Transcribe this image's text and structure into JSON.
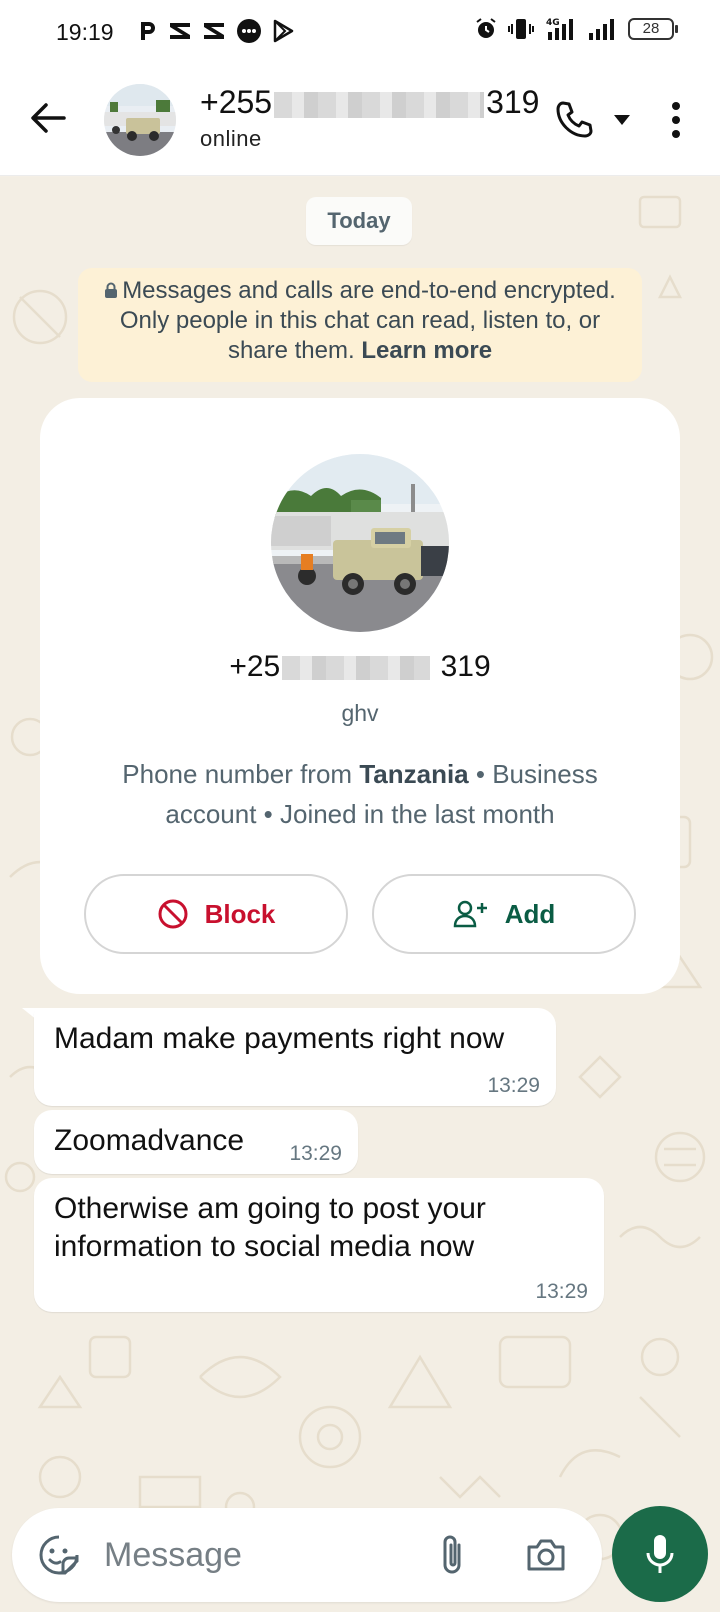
{
  "status_bar": {
    "time": "19:19",
    "battery": "28",
    "network": "4G",
    "icons_left": [
      "p-icon",
      "capcut-icon",
      "capcut-icon",
      "messenger-icon",
      "play-store-icon"
    ],
    "icons_right": [
      "alarm-icon",
      "vibrate-icon",
      "signal-4g-icon",
      "signal-icon",
      "battery-icon"
    ]
  },
  "header": {
    "number_prefix": "+255",
    "number_suffix": "319",
    "status": "online",
    "icons": [
      "back-arrow-icon",
      "phone-icon",
      "caret-down-icon",
      "more-vert-icon"
    ]
  },
  "chat": {
    "date_label": "Today",
    "encryption": {
      "text": "Messages and calls are end-to-end encrypted. Only people in this chat can read, listen to, or share them.",
      "link": "Learn more"
    },
    "contact_card": {
      "number_prefix": "+25",
      "number_suffix": "319",
      "business_name": "ghv",
      "info_prefix": "Phone number from ",
      "country": "Tanzania",
      "info_suffix": " • Business account • Joined in the last month",
      "block_label": "Block",
      "add_label": "Add"
    },
    "messages": [
      {
        "text": "Madam make payments right now",
        "time": "13:29"
      },
      {
        "text": "Zoomadvance",
        "time": "13:29"
      },
      {
        "text": "Otherwise am going to post your information to social media now",
        "time": "13:29"
      }
    ]
  },
  "composer": {
    "placeholder": "Message"
  },
  "colors": {
    "accent_green": "#1b6b49",
    "block_red": "#c8102e",
    "add_green": "#0a5c44",
    "notice_bg": "#fdf1d6",
    "wallpaper": "#f3eee4"
  }
}
